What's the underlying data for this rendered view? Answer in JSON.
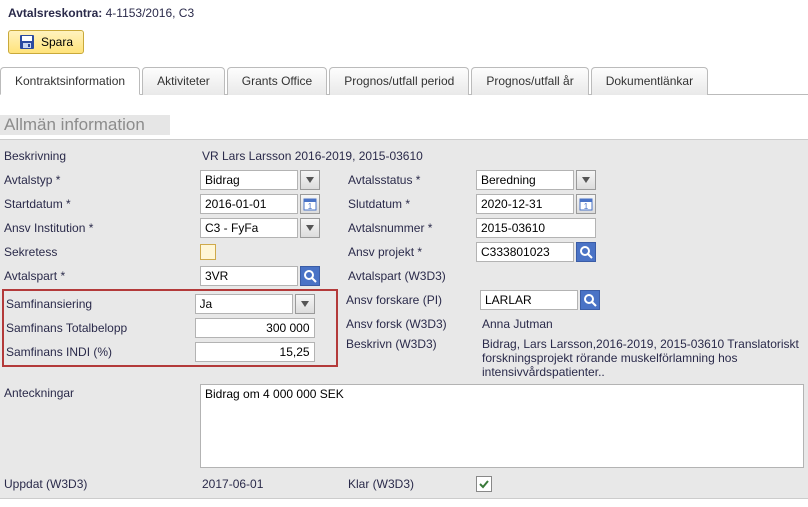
{
  "header": {
    "label": "Avtalsreskontra:",
    "value": "4-1153/2016, C3"
  },
  "toolbar": {
    "save_label": "Spara"
  },
  "tabs": [
    {
      "label": "Kontraktsinformation",
      "active": true
    },
    {
      "label": "Aktiviteter"
    },
    {
      "label": "Grants Office"
    },
    {
      "label": "Prognos/utfall period"
    },
    {
      "label": "Prognos/utfall år"
    },
    {
      "label": "Dokumentlänkar"
    }
  ],
  "section_title": "Allmän information",
  "fields": {
    "beskrivning": {
      "label": "Beskrivning",
      "value": "VR Lars Larsson 2016-2019, 2015-03610"
    },
    "avtalstyp": {
      "label": "Avtalstyp *",
      "value": "Bidrag"
    },
    "avtalsstatus": {
      "label": "Avtalsstatus *",
      "value": "Beredning"
    },
    "startdatum": {
      "label": "Startdatum *",
      "value": "2016-01-01"
    },
    "slutdatum": {
      "label": "Slutdatum *",
      "value": "2020-12-31"
    },
    "ansv_institution": {
      "label": "Ansv Institution *",
      "value": "C3 - FyFa"
    },
    "avtalsnummer": {
      "label": "Avtalsnummer *",
      "value": "2015-03610"
    },
    "sekretess": {
      "label": "Sekretess"
    },
    "ansv_projekt": {
      "label": "Ansv projekt *",
      "value": "C333801023"
    },
    "avtalspart": {
      "label": "Avtalspart *",
      "value": "3VR"
    },
    "avtalspart_w3d3": {
      "label": "Avtalspart (W3D3)"
    },
    "samfinansiering": {
      "label": "Samfinansiering",
      "value": "Ja"
    },
    "ansv_forskare": {
      "label": "Ansv forskare (PI)",
      "value": "LARLAR"
    },
    "samfinans_total": {
      "label": "Samfinans Totalbelopp",
      "value": "300 000"
    },
    "ansv_forsk_w3d3": {
      "label": "Ansv forsk (W3D3)",
      "value": "Anna Jutman"
    },
    "samfinans_indi": {
      "label": "Samfinans INDI (%)",
      "value": "15,25"
    },
    "beskrivn_w3d3": {
      "label": "Beskrivn (W3D3)",
      "value": "Bidrag, Lars Larsson,2016-2019, 2015-03610 Translatoriskt forskningsprojekt rörande muskelförlamning hos intensivvårdspatienter.."
    },
    "anteckningar": {
      "label": "Anteckningar",
      "value": "Bidrag om 4 000 000 SEK"
    },
    "uppdat_w3d3": {
      "label": "Uppdat (W3D3)",
      "value": "2017-06-01"
    },
    "klar_w3d3": {
      "label": "Klar (W3D3)",
      "checked": true
    }
  }
}
